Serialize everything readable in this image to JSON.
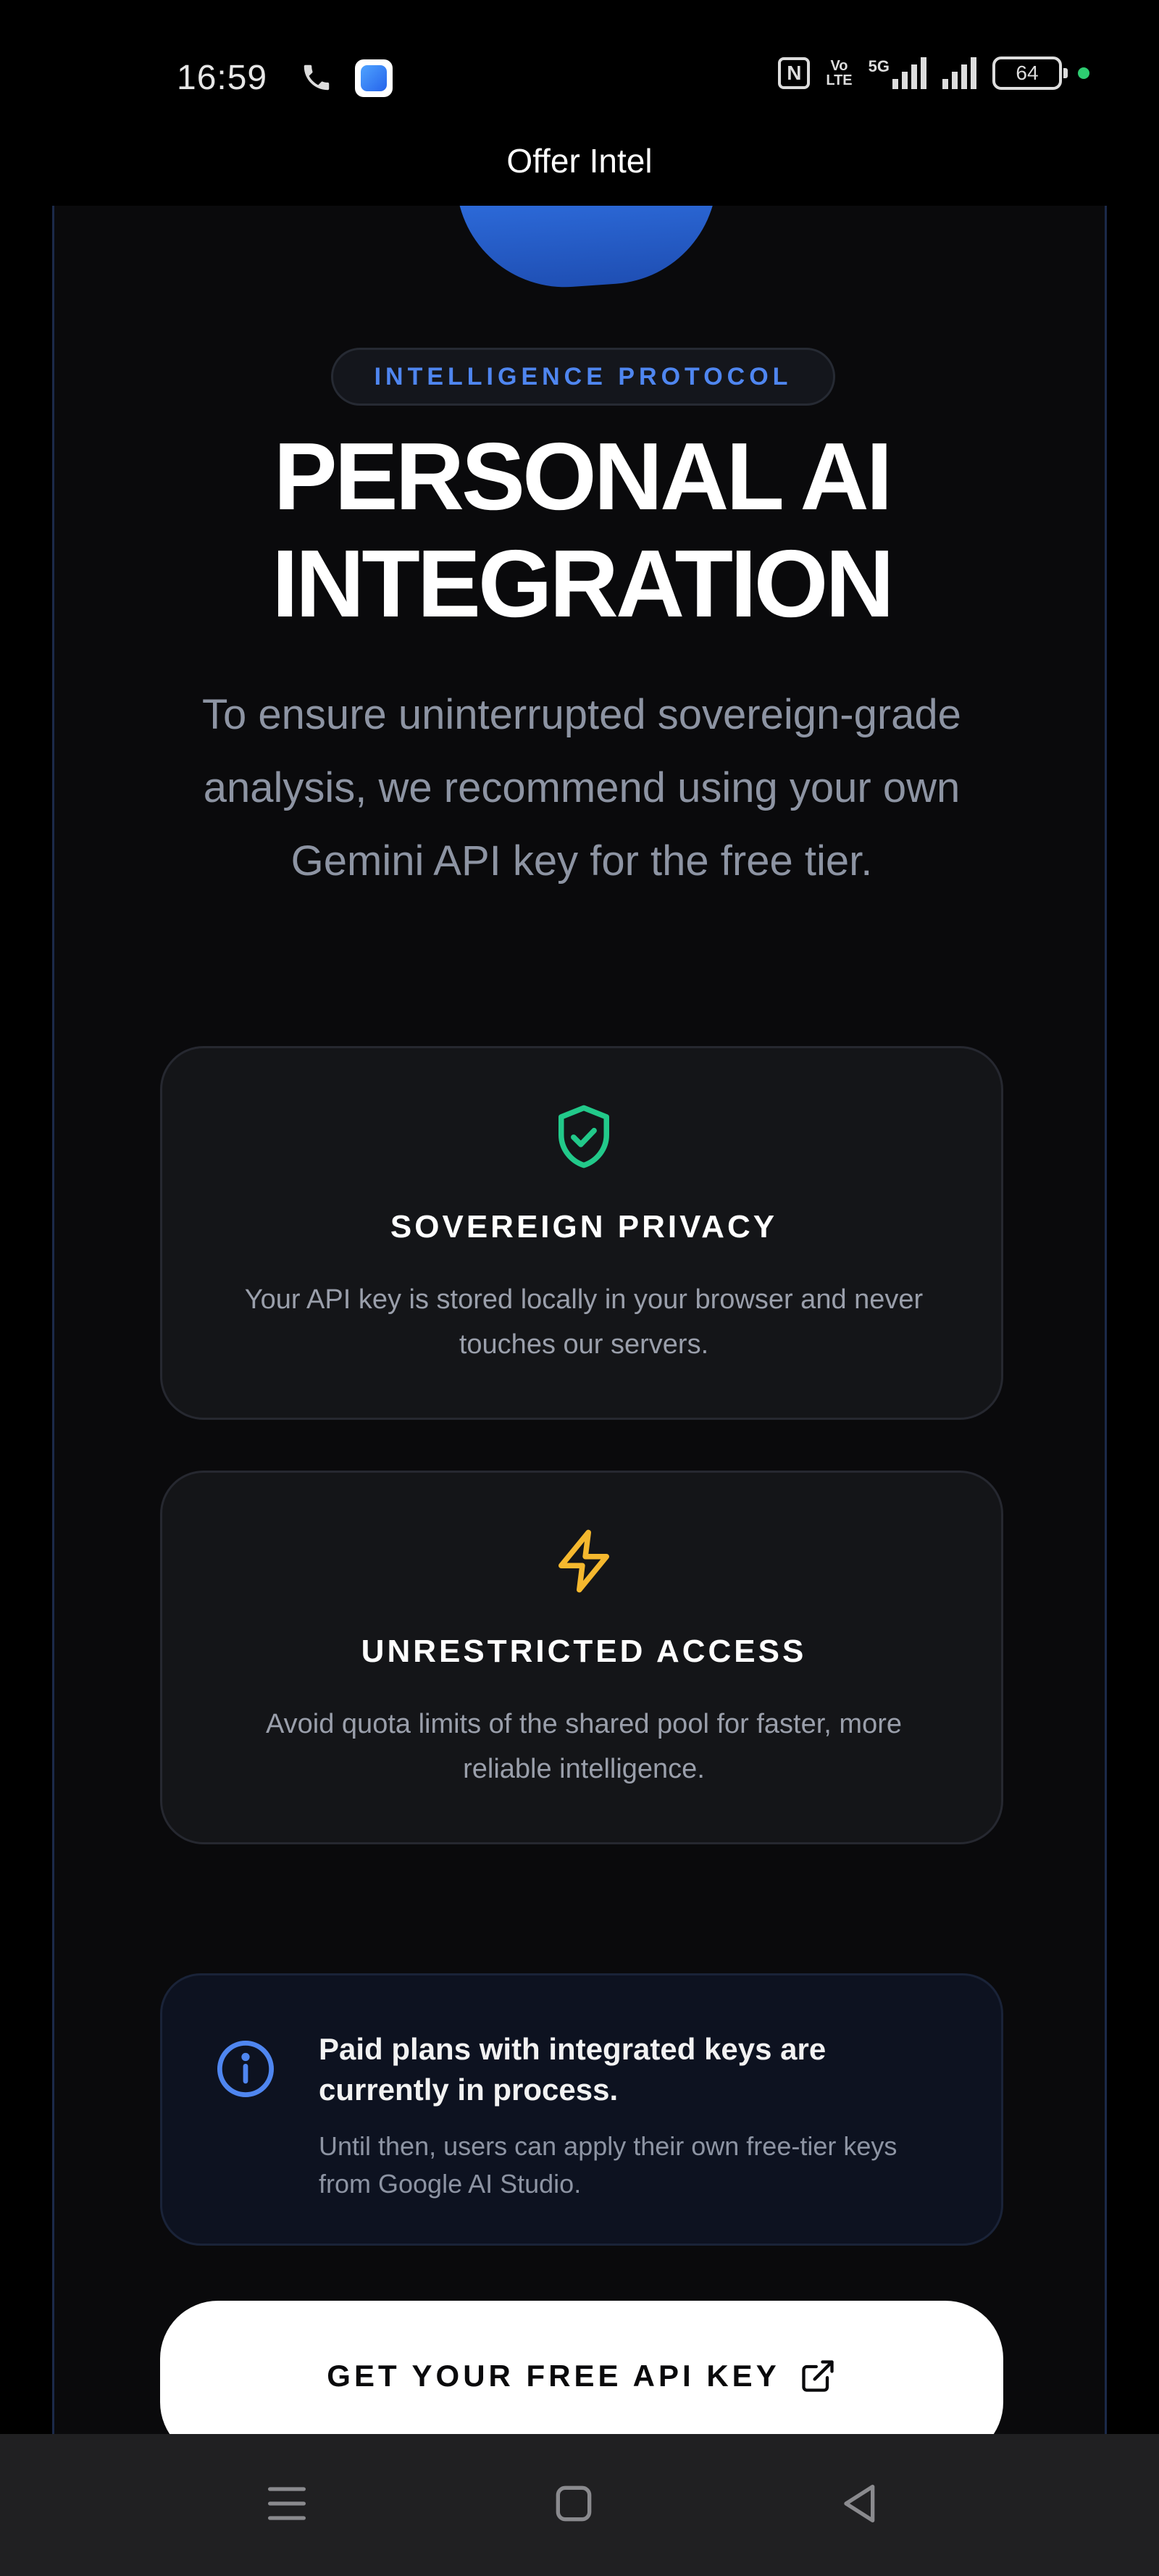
{
  "status_bar": {
    "time": "16:59",
    "icons": [
      "phone-icon",
      "app-notification-icon",
      "nfc-icon",
      "volte-icon",
      "5g-signal-icon",
      "signal-icon",
      "battery-icon"
    ],
    "nfc_label": "N",
    "volte_label_top": "Vo",
    "volte_label_bottom": "LTE",
    "network_label": "5G",
    "battery_level": "64",
    "dot_color": "#2ecc71"
  },
  "app": {
    "title": "Offer Intel"
  },
  "hero": {
    "badge": "INTELLIGENCE PROTOCOL",
    "headline_line1": "PERSONAL AI",
    "headline_line2": "INTEGRATION",
    "subtitle": "To ensure uninterrupted sovereign-grade analysis, we recommend using your own Gemini API key for the free tier."
  },
  "features": [
    {
      "icon": "shield-check-icon",
      "icon_color": "#22c98a",
      "title": "SOVEREIGN PRIVACY",
      "text": "Your API key is stored locally in your browser and never touches our servers."
    },
    {
      "icon": "lightning-icon",
      "icon_color": "#f5b82e",
      "title": "UNRESTRICTED ACCESS",
      "text": "Avoid quota limits of the shared pool for faster, more reliable intelligence."
    }
  ],
  "notice": {
    "icon": "info-icon",
    "title": "Paid plans with integrated keys are currently in process.",
    "text": "Until then, users can apply their own free-tier keys from Google AI Studio."
  },
  "cta": {
    "label": "GET YOUR FREE API KEY",
    "icon": "external-link-icon"
  },
  "nav_bar": {
    "icons": [
      "menu-icon",
      "home-icon",
      "back-icon"
    ]
  },
  "colors": {
    "accent": "#4f86f0",
    "background": "#0a0a0c",
    "card": "#141518"
  }
}
